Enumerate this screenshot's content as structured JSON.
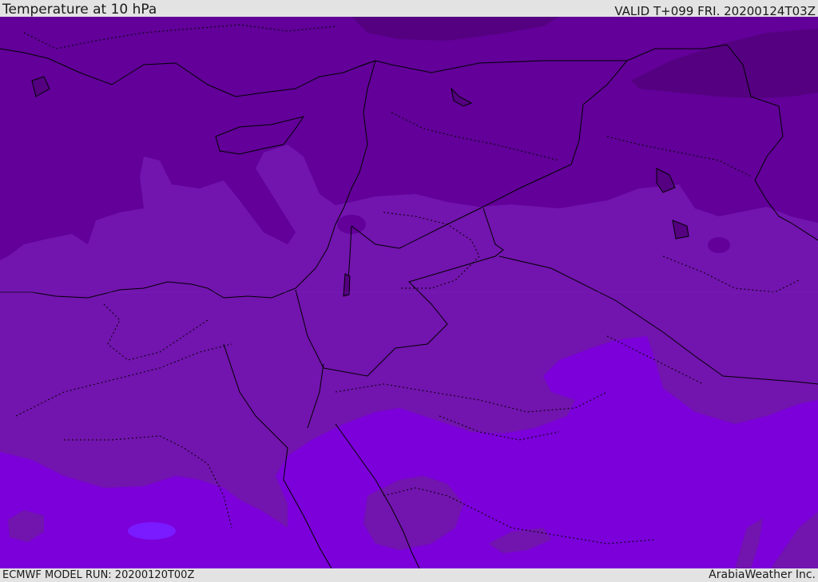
{
  "header": {
    "title": "Temperature at 10 hPa",
    "valid": "VALID T+099 FRI. 20200124T03Z"
  },
  "footer": {
    "model_run": "ECMWF MODEL RUN: 20200120T00Z",
    "credit": "ArabiaWeather Inc."
  },
  "colors": {
    "coldest": "#540080",
    "cold": "#620099",
    "mid": "#7214ae",
    "warm": "#7b00d9",
    "warmest": "#7a1aff",
    "border": "#000000"
  }
}
